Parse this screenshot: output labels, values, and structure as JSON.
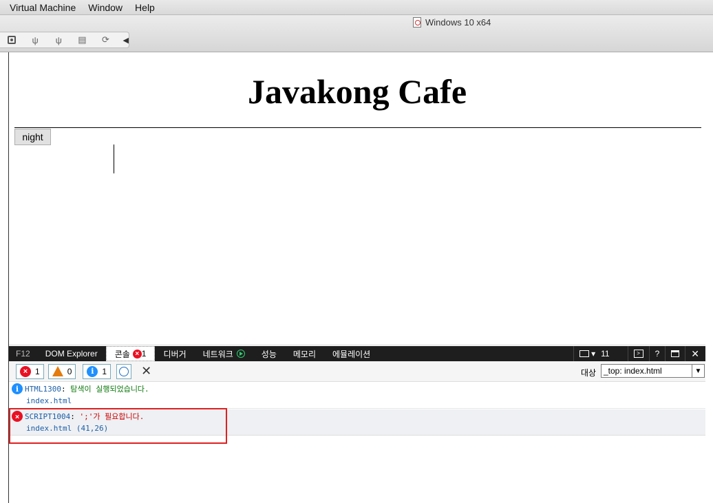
{
  "menubar": {
    "items": [
      "Virtual Machine",
      "Window",
      "Help"
    ]
  },
  "vm": {
    "title": "Windows 10 x64"
  },
  "page": {
    "title": "Javakong Cafe",
    "night_button": "night"
  },
  "devtools": {
    "tabs": {
      "f12": "F12",
      "dom": "DOM Explorer",
      "console": "콘솔",
      "console_errors": "1",
      "debugger": "디버거",
      "network": "네트워크",
      "performance": "성능",
      "memory": "메모리",
      "emulation": "에뮬레이션"
    },
    "doc_mode": "11",
    "filters": {
      "errors": "1",
      "warnings": "0",
      "messages": "1"
    },
    "target_label": "대상",
    "target_value": "_top: index.html",
    "log": [
      {
        "code": "HTML1300",
        "message": "탐색이 실행되었습니다.",
        "source": "index.html"
      },
      {
        "code": "SCRIPT1004",
        "message": "';'가 필요합니다.",
        "source": "index.html (41,26)"
      }
    ]
  }
}
